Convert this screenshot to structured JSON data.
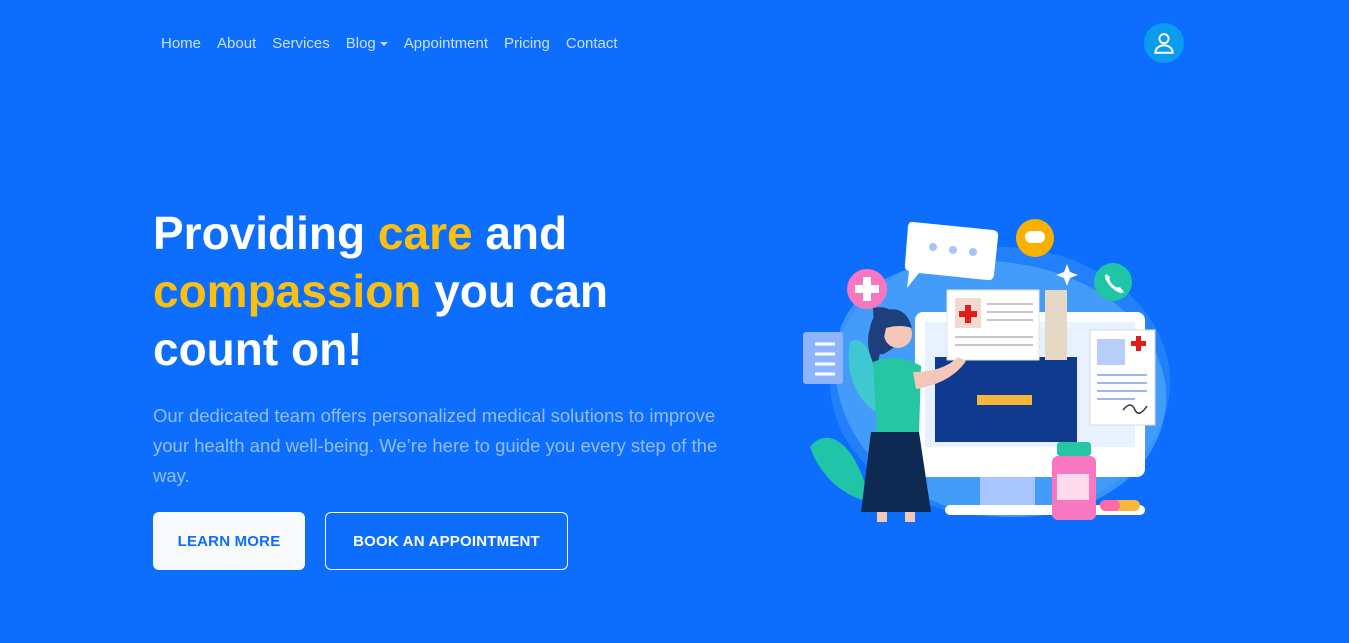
{
  "nav": {
    "items": [
      {
        "label": "Home"
      },
      {
        "label": "About"
      },
      {
        "label": "Services"
      },
      {
        "label": "Blog"
      },
      {
        "label": "Appointment"
      },
      {
        "label": "Pricing"
      },
      {
        "label": "Contact"
      }
    ]
  },
  "hero": {
    "title_part1": "Providing ",
    "title_highlight1": "care",
    "title_part2": " and",
    "title_highlight2": "compassion",
    "title_part3": " you can count on!",
    "description": "Our dedicated team offers personalized medical solutions to improve your health and well-being. We’re here to guide you every step of the way.",
    "buttons": {
      "learn_more": "LEARN MORE",
      "book": "BOOK AN APPOINTMENT"
    }
  },
  "colors": {
    "background": "#0d6efd",
    "accent": "#fbbf12",
    "avatar": "#0b9bef"
  },
  "icons": [
    "user-icon",
    "dropdown-caret-icon"
  ]
}
